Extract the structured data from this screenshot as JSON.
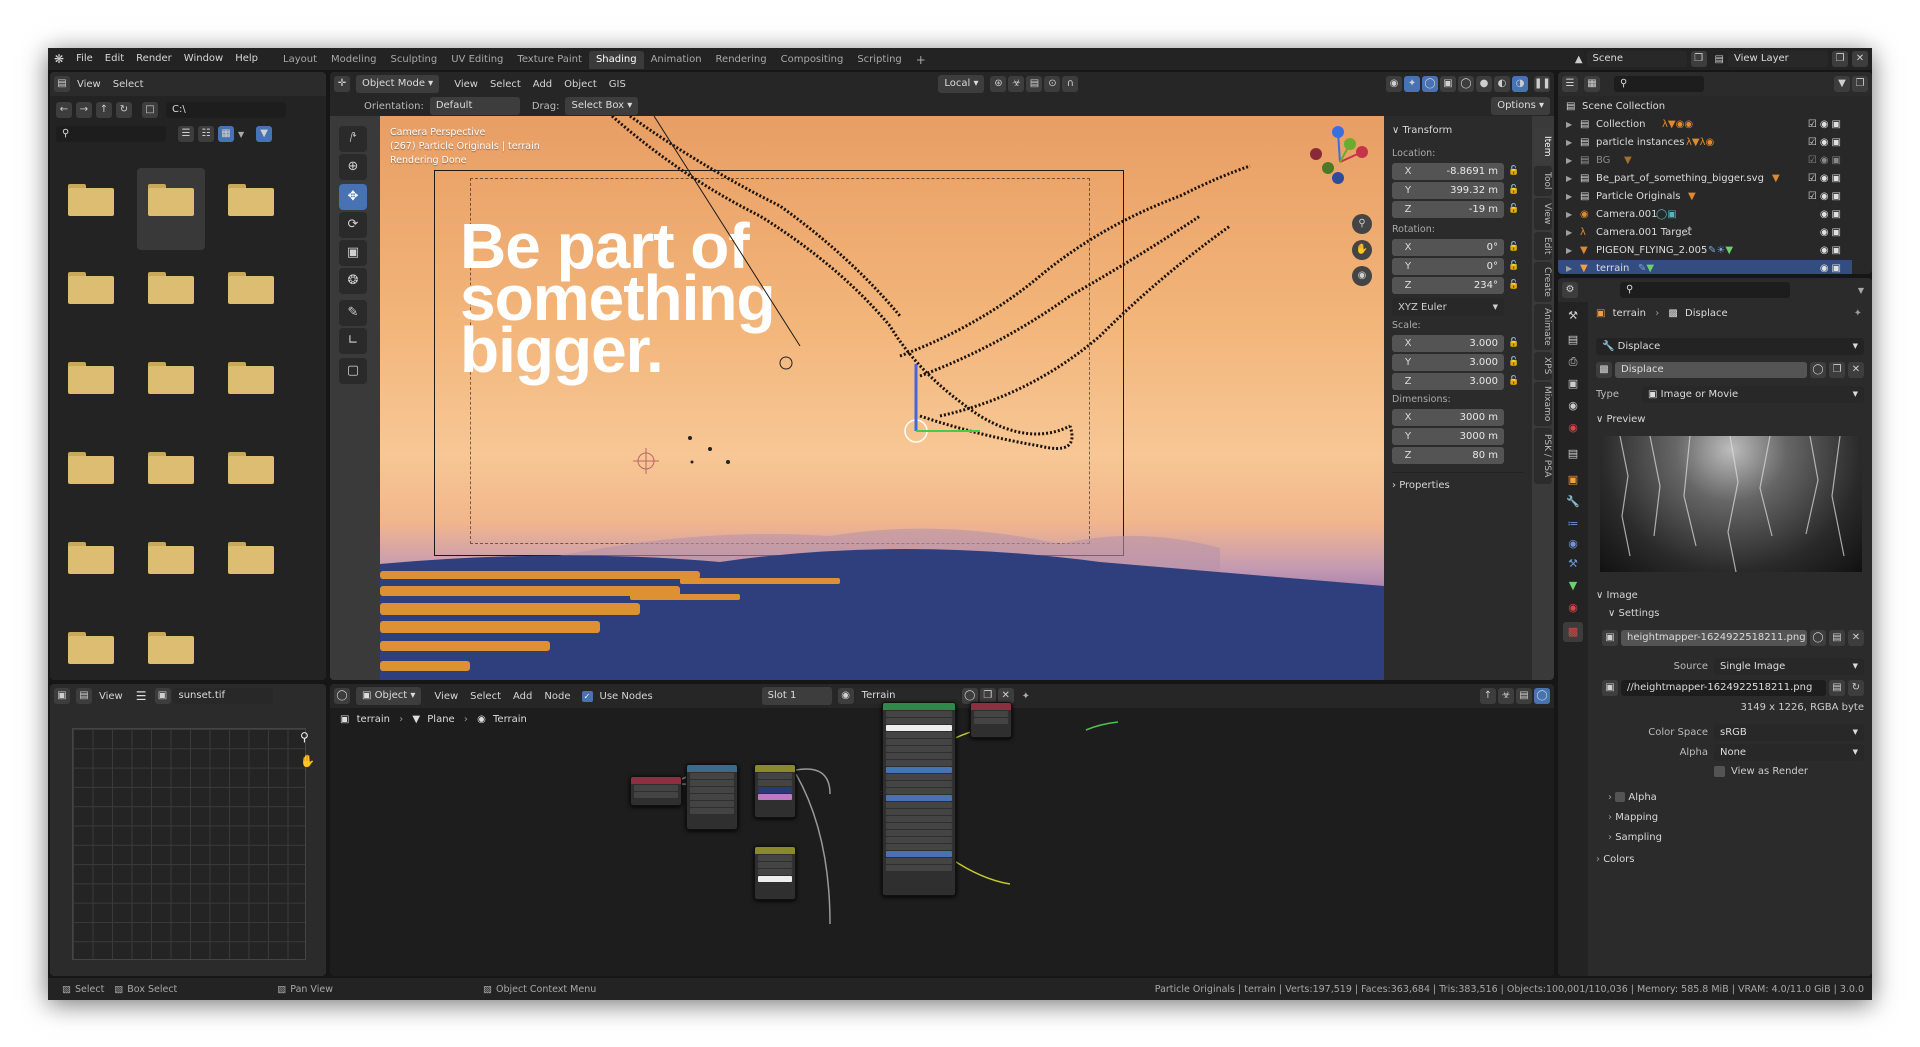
{
  "menu": {
    "items": [
      "File",
      "Edit",
      "Render",
      "Window",
      "Help"
    ]
  },
  "workspaces": {
    "tabs": [
      "Layout",
      "Modeling",
      "Sculpting",
      "UV Editing",
      "Texture Paint",
      "Shading",
      "Animation",
      "Rendering",
      "Compositing",
      "Scripting"
    ],
    "active": "Shading",
    "add": "+"
  },
  "scene": {
    "scene_label": "Scene",
    "view_layer_label": "View Layer"
  },
  "filebrowser": {
    "view": "View",
    "select": "Select",
    "path": "C:\\"
  },
  "viewport": {
    "mode": "Object Mode",
    "view": "View",
    "select": "Select",
    "add": "Add",
    "object": "Object",
    "gis": "GIS",
    "transform_space": "Local",
    "orientation_label": "Orientation:",
    "orientation_value": "Default",
    "drag_label": "Drag:",
    "drag_value": "Select Box",
    "options": "Options",
    "info_line1": "Camera Perspective",
    "info_line2": "(267) Particle Originals | terrain",
    "info_line3": "Rendering Done",
    "poster_text": "Be part of something bigger."
  },
  "npanel": {
    "transform_title": "Transform",
    "location_label": "Location:",
    "location": [
      {
        "axis": "X",
        "value": "-8.8691 m"
      },
      {
        "axis": "Y",
        "value": "399.32 m"
      },
      {
        "axis": "Z",
        "value": "-19 m"
      }
    ],
    "rotation_label": "Rotation:",
    "rotation": [
      {
        "axis": "X",
        "value": "0°"
      },
      {
        "axis": "Y",
        "value": "0°"
      },
      {
        "axis": "Z",
        "value": "234°"
      }
    ],
    "rotation_mode": "XYZ Euler",
    "scale_label": "Scale:",
    "scale": [
      {
        "axis": "X",
        "value": "3.000"
      },
      {
        "axis": "Y",
        "value": "3.000"
      },
      {
        "axis": "Z",
        "value": "3.000"
      }
    ],
    "dimensions_label": "Dimensions:",
    "dimensions": [
      {
        "axis": "X",
        "value": "3000 m"
      },
      {
        "axis": "Y",
        "value": "3000 m"
      },
      {
        "axis": "Z",
        "value": "80 m"
      }
    ],
    "properties_title": "Properties",
    "tabs": [
      "Item",
      "Tool",
      "View",
      "Edit",
      "Create",
      "Animate",
      "XPS",
      "Mixamo",
      "PSK / PSA"
    ]
  },
  "outliner": {
    "root": "Scene Collection",
    "items": [
      "Collection",
      "particle instances",
      "BG",
      "Be_part_of_something_bigger.svg",
      "Particle Originals",
      "Camera.001",
      "Camera.001 Target",
      "PIGEON_FLYING_2.005",
      "terrain"
    ]
  },
  "properties": {
    "breadcrumb_object": "terrain",
    "breadcrumb_modifier": "Displace",
    "modifier_dropdown": "Displace",
    "texture_name": "Displace",
    "type_label": "Type",
    "type_value": "Image or Movie",
    "preview_title": "Preview",
    "image_title": "Image",
    "settings_title": "Settings",
    "image_file": "heightmapper-1624922518211.png",
    "source_label": "Source",
    "source_value": "Single Image",
    "filepath": "//heightmapper-1624922518211.png",
    "image_info": "3149 x 1226, RGBA byte",
    "colorspace_label": "Color Space",
    "colorspace_value": "sRGB",
    "alpha_label": "Alpha",
    "alpha_value": "None",
    "view_as_render": "View as Render",
    "alpha_section": "Alpha",
    "mapping_section": "Mapping",
    "sampling_section": "Sampling",
    "colors_section": "Colors"
  },
  "image_editor": {
    "view": "View",
    "image_name": "sunset.tif"
  },
  "node_editor": {
    "object_type": "Object",
    "view": "View",
    "select": "Select",
    "add": "Add",
    "node": "Node",
    "use_nodes": "Use Nodes",
    "slot": "Slot 1",
    "material": "Terrain",
    "breadcrumb": [
      "terrain",
      "Plane",
      "Terrain"
    ]
  },
  "statusbar": {
    "select": "Select",
    "box_select": "Box Select",
    "pan_view": "Pan View",
    "context_menu": "Object Context Menu",
    "stats": "Particle Originals | terrain | Verts:197,519 | Faces:363,684 | Tris:383,516 | Objects:100,001/110,036 | Memory: 585.8 MiB | VRAM: 4.0/11.0 GiB | 3.0.0"
  },
  "colors": {
    "accent": "#4772b3",
    "outliner_selected": "#334d80",
    "sky_top": "#e9a46a",
    "sky_bottom": "#f7c592",
    "sea": "#2f3f7e",
    "folder": "#dcbd72"
  }
}
